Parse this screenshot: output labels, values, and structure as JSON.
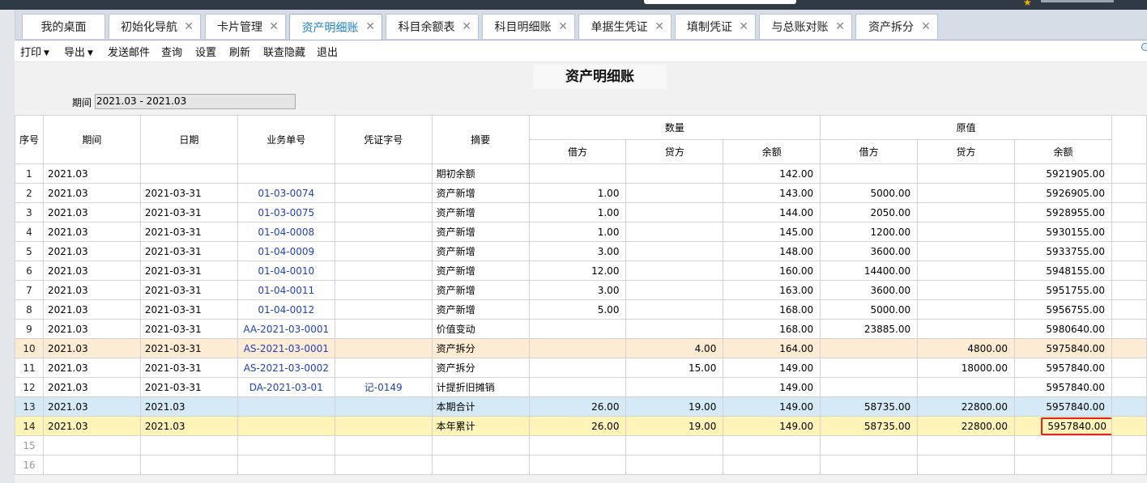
{
  "tabs": [
    {
      "label": "我的桌面",
      "closable": false
    },
    {
      "label": "初始化导航",
      "closable": true
    },
    {
      "label": "卡片管理",
      "closable": true
    },
    {
      "label": "资产明细账",
      "closable": true,
      "active": true
    },
    {
      "label": "科目余额表",
      "closable": true
    },
    {
      "label": "科目明细账",
      "closable": true
    },
    {
      "label": "单据生凭证",
      "closable": true
    },
    {
      "label": "填制凭证",
      "closable": true
    },
    {
      "label": "与总账对账",
      "closable": true
    },
    {
      "label": "资产拆分",
      "closable": true
    }
  ],
  "toolbar": {
    "print": "打印",
    "export": "导出",
    "send_mail": "发送邮件",
    "query": "查询",
    "settings": "设置",
    "refresh": "刷新",
    "linked_hide": "联查隐藏",
    "exit": "退出"
  },
  "report": {
    "title": "资产明细账",
    "period_label": "期间",
    "period_value": "2021.03 - 2021.03"
  },
  "columns": {
    "seq": "序号",
    "period": "期间",
    "date": "日期",
    "doc_no": "业务单号",
    "voucher": "凭证字号",
    "summary": "摘要",
    "qty_group": "数量",
    "orig_group": "原值",
    "debit": "借方",
    "credit": "贷方",
    "balance": "余额"
  },
  "rows": [
    {
      "seq": "1",
      "period": "2021.03",
      "date": "",
      "doc": "",
      "voucher": "",
      "summary": "期初余额",
      "qd": "",
      "qc": "",
      "qb": "142.00",
      "od": "",
      "oc": "",
      "ob": "5921905.00",
      "style": ""
    },
    {
      "seq": "2",
      "period": "2021.03",
      "date": "2021-03-31",
      "doc": "01-03-0074",
      "voucher": "",
      "summary": "资产新增",
      "qd": "1.00",
      "qc": "",
      "qb": "143.00",
      "od": "5000.00",
      "oc": "",
      "ob": "5926905.00",
      "style": ""
    },
    {
      "seq": "3",
      "period": "2021.03",
      "date": "2021-03-31",
      "doc": "01-03-0075",
      "voucher": "",
      "summary": "资产新增",
      "qd": "1.00",
      "qc": "",
      "qb": "144.00",
      "od": "2050.00",
      "oc": "",
      "ob": "5928955.00",
      "style": ""
    },
    {
      "seq": "4",
      "period": "2021.03",
      "date": "2021-03-31",
      "doc": "01-04-0008",
      "voucher": "",
      "summary": "资产新增",
      "qd": "1.00",
      "qc": "",
      "qb": "145.00",
      "od": "1200.00",
      "oc": "",
      "ob": "5930155.00",
      "style": ""
    },
    {
      "seq": "5",
      "period": "2021.03",
      "date": "2021-03-31",
      "doc": "01-04-0009",
      "voucher": "",
      "summary": "资产新增",
      "qd": "3.00",
      "qc": "",
      "qb": "148.00",
      "od": "3600.00",
      "oc": "",
      "ob": "5933755.00",
      "style": ""
    },
    {
      "seq": "6",
      "period": "2021.03",
      "date": "2021-03-31",
      "doc": "01-04-0010",
      "voucher": "",
      "summary": "资产新增",
      "qd": "12.00",
      "qc": "",
      "qb": "160.00",
      "od": "14400.00",
      "oc": "",
      "ob": "5948155.00",
      "style": ""
    },
    {
      "seq": "7",
      "period": "2021.03",
      "date": "2021-03-31",
      "doc": "01-04-0011",
      "voucher": "",
      "summary": "资产新增",
      "qd": "3.00",
      "qc": "",
      "qb": "163.00",
      "od": "3600.00",
      "oc": "",
      "ob": "5951755.00",
      "style": ""
    },
    {
      "seq": "8",
      "period": "2021.03",
      "date": "2021-03-31",
      "doc": "01-04-0012",
      "voucher": "",
      "summary": "资产新增",
      "qd": "5.00",
      "qc": "",
      "qb": "168.00",
      "od": "5000.00",
      "oc": "",
      "ob": "5956755.00",
      "style": ""
    },
    {
      "seq": "9",
      "period": "2021.03",
      "date": "2021-03-31",
      "doc": "AA-2021-03-0001",
      "voucher": "",
      "summary": "价值变动",
      "qd": "",
      "qc": "",
      "qb": "168.00",
      "od": "23885.00",
      "oc": "",
      "ob": "5980640.00",
      "style": ""
    },
    {
      "seq": "10",
      "period": "2021.03",
      "date": "2021-03-31",
      "doc": "AS-2021-03-0001",
      "voucher": "",
      "summary": "资产拆分",
      "qd": "",
      "qc": "4.00",
      "qb": "164.00",
      "od": "",
      "oc": "4800.00",
      "ob": "5975840.00",
      "style": "orange"
    },
    {
      "seq": "11",
      "period": "2021.03",
      "date": "2021-03-31",
      "doc": "AS-2021-03-0002",
      "voucher": "",
      "summary": "资产拆分",
      "qd": "",
      "qc": "15.00",
      "qb": "149.00",
      "od": "",
      "oc": "18000.00",
      "ob": "5957840.00",
      "style": ""
    },
    {
      "seq": "12",
      "period": "2021.03",
      "date": "2021-03-31",
      "doc": "DA-2021-03-01",
      "voucher": "记-0149",
      "summary": "计提折旧摊销",
      "qd": "",
      "qc": "",
      "qb": "149.00",
      "od": "",
      "oc": "",
      "ob": "5957840.00",
      "style": ""
    },
    {
      "seq": "13",
      "period": "2021.03",
      "date": "2021.03",
      "doc": "",
      "voucher": "",
      "summary": "本期合计",
      "qd": "26.00",
      "qc": "19.00",
      "qb": "149.00",
      "od": "58735.00",
      "oc": "22800.00",
      "ob": "5957840.00",
      "style": "blue"
    },
    {
      "seq": "14",
      "period": "2021.03",
      "date": "2021.03",
      "doc": "",
      "voucher": "",
      "summary": "本年累计",
      "qd": "26.00",
      "qc": "19.00",
      "qb": "149.00",
      "od": "58735.00",
      "oc": "22800.00",
      "ob": "5957840.00",
      "style": "yellow",
      "highlight": true
    },
    {
      "seq": "15",
      "period": "",
      "date": "",
      "doc": "",
      "voucher": "",
      "summary": "",
      "qd": "",
      "qc": "",
      "qb": "",
      "od": "",
      "oc": "",
      "ob": "",
      "style": "empty"
    },
    {
      "seq": "16",
      "period": "",
      "date": "",
      "doc": "",
      "voucher": "",
      "summary": "",
      "qd": "",
      "qc": "",
      "qb": "",
      "od": "",
      "oc": "",
      "ob": "",
      "style": "empty"
    }
  ]
}
